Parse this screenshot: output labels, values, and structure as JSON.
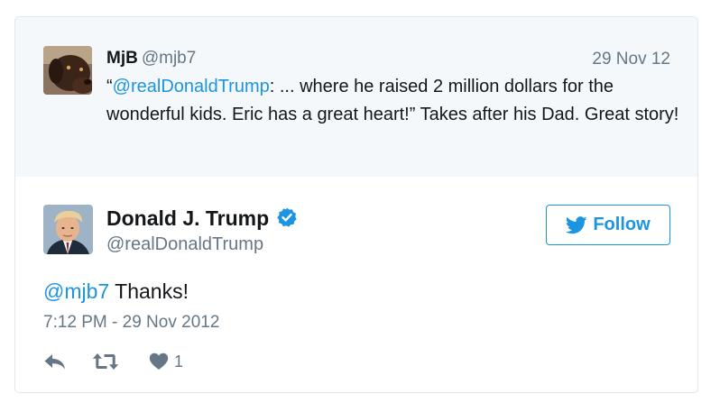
{
  "quoted_tweet": {
    "name": "MjB",
    "handle": "@mjb7",
    "date": "29 Nov 12",
    "text_open_quote": "“",
    "text_mention": "@realDonaldTrump",
    "text_body": ": ... where he raised 2 million dollars for the wonderful kids. Eric has a great heart!” Takes after his Dad. Great story!"
  },
  "tweet": {
    "name": "Donald J. Trump",
    "handle": "@realDonaldTrump",
    "verified": true,
    "follow_label": "Follow",
    "reply_mention": "@mjb7",
    "text": " Thanks!",
    "timestamp": "7:12 PM - 29 Nov 2012",
    "like_count": "1"
  },
  "colors": {
    "accent": "#1b95e0",
    "secondary_text": "#657786",
    "quoted_bg": "#f5f8fa",
    "border": "#e1e8ed"
  },
  "icons": {
    "verified": "verified-badge-icon",
    "follow": "twitter-bird-icon",
    "reply": "reply-icon",
    "retweet": "retweet-icon",
    "like": "heart-icon"
  }
}
